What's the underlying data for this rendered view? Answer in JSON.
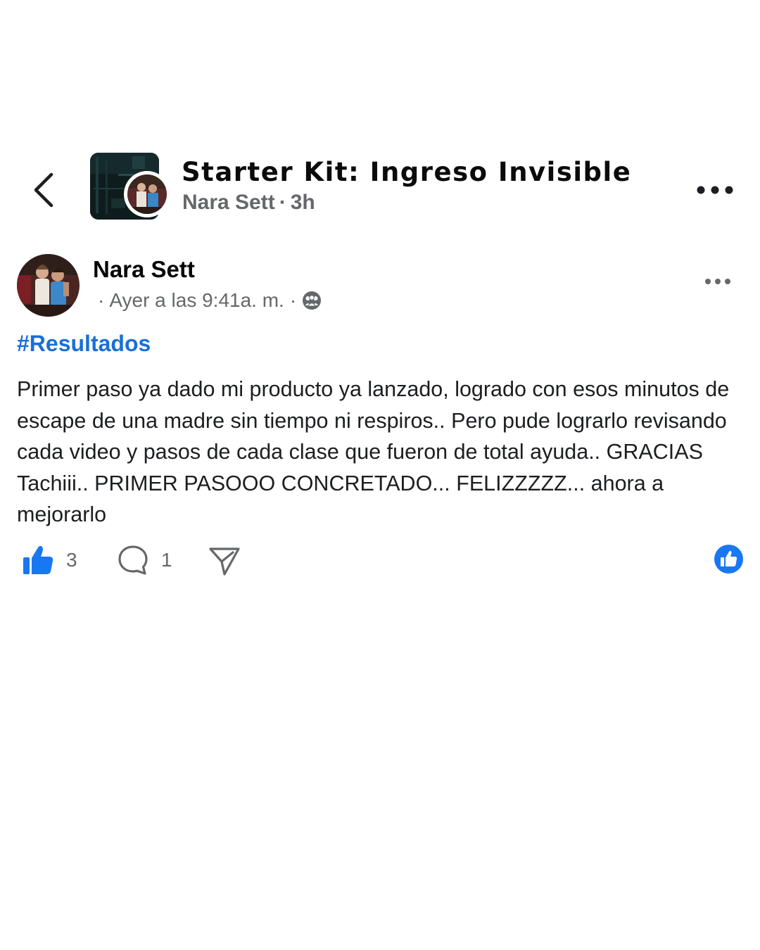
{
  "header": {
    "group_title": "Starter Kit: Ingreso Invisible",
    "author": "Nara Sett",
    "separator": "·",
    "time": "3h",
    "back_icon": "chevron-left-icon",
    "more_icon": "more-horizontal-icon"
  },
  "post": {
    "author": "Nara Sett",
    "meta_sep": "·",
    "timestamp": "Ayer a las 9:41a. m.",
    "audience_icon": "members-icon",
    "hashtag": "#Resultados",
    "body": "Primer paso ya dado mi producto ya lanzado, logrado con esos minutos de escape de una madre sin tiempo ni respiros.. Pero pude lograrlo revisando cada video y pasos de cada clase que fueron de total ayuda.. GRACIAS Tachiii.. PRIMER PASOOO CONCRETADO... FELIZZZZZ... ahora a mejorarlo"
  },
  "actions": {
    "likes": "3",
    "comments": "1",
    "like_icon": "thumbs-up-icon",
    "comment_icon": "comment-bubble-icon",
    "share_icon": "share-send-icon",
    "reaction_icon": "like-reaction-icon"
  },
  "colors": {
    "accent": "#1877f2",
    "hashtag": "#1a6fd8",
    "secondary_text": "#65676b"
  }
}
